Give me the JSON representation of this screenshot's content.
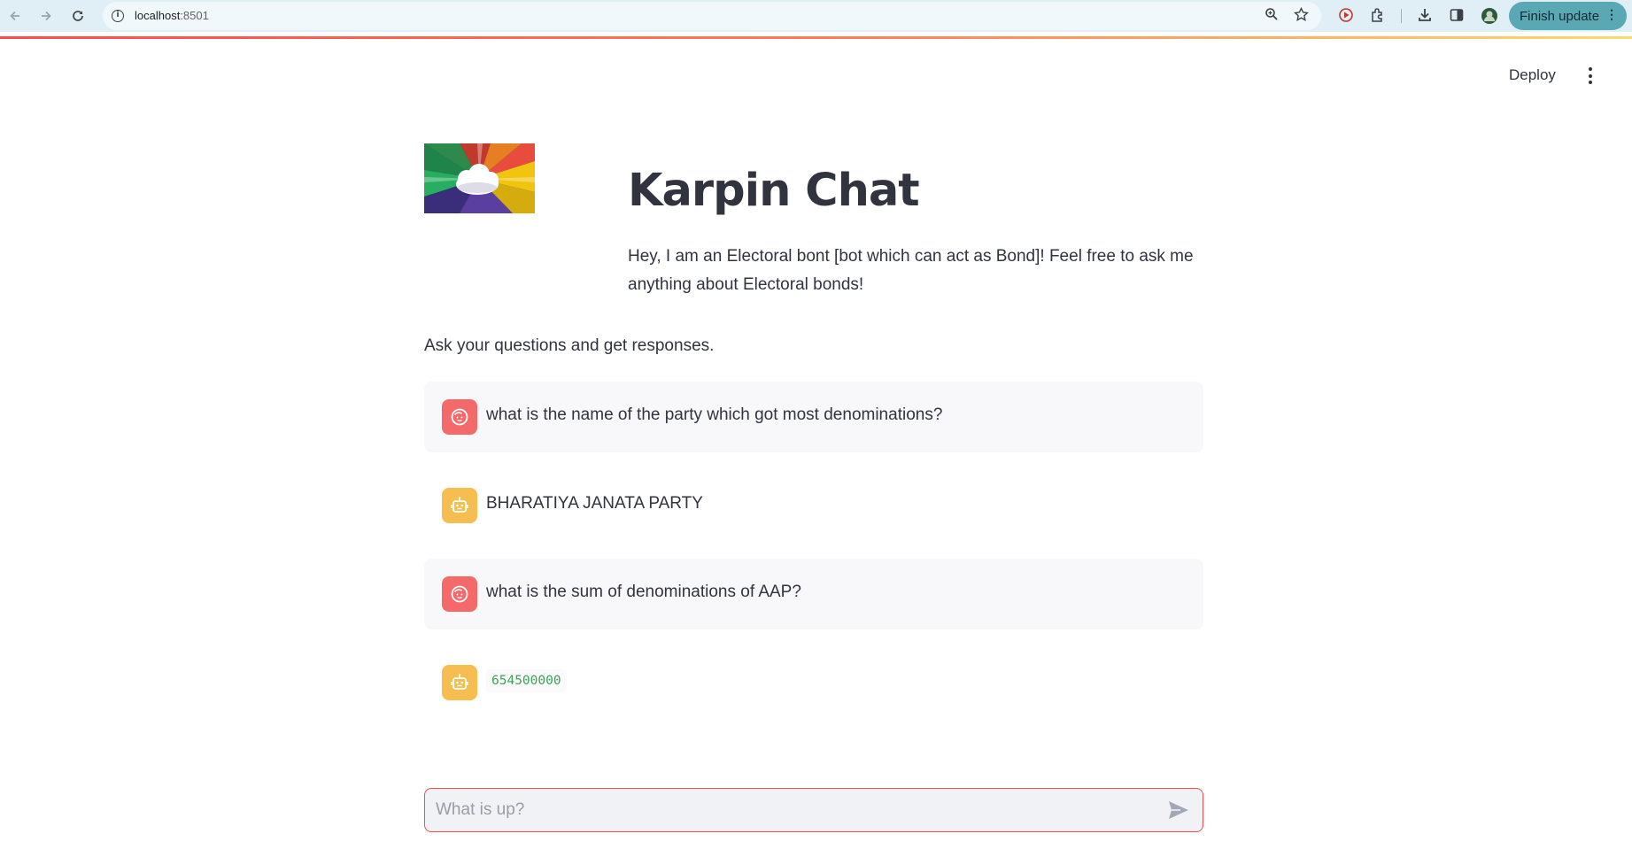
{
  "browser": {
    "url_host": "localhost",
    "url_port": ":8501",
    "update_label": "Finish update"
  },
  "header": {
    "deploy_label": "Deploy"
  },
  "app": {
    "title": "Karpin Chat",
    "intro": "Hey, I am an Electoral bont [bot which can act as Bond]! Feel free to ask me anything about Electoral bonds!",
    "prompt": "Ask your questions and get responses."
  },
  "messages": [
    {
      "role": "user",
      "text": "what is the name of the party which got most denominations?"
    },
    {
      "role": "assistant",
      "text": "BHARATIYA JANATA PARTY"
    },
    {
      "role": "user",
      "text": "what is the sum of denominations of AAP?"
    },
    {
      "role": "assistant",
      "text": "654500000"
    }
  ],
  "chat_input": {
    "placeholder": "What is up?"
  },
  "colors": {
    "accent": "#ff4b4b",
    "user_avatar": "#f46a6a",
    "bot_avatar": "#f6bd51",
    "code_text": "#3fa05b"
  }
}
